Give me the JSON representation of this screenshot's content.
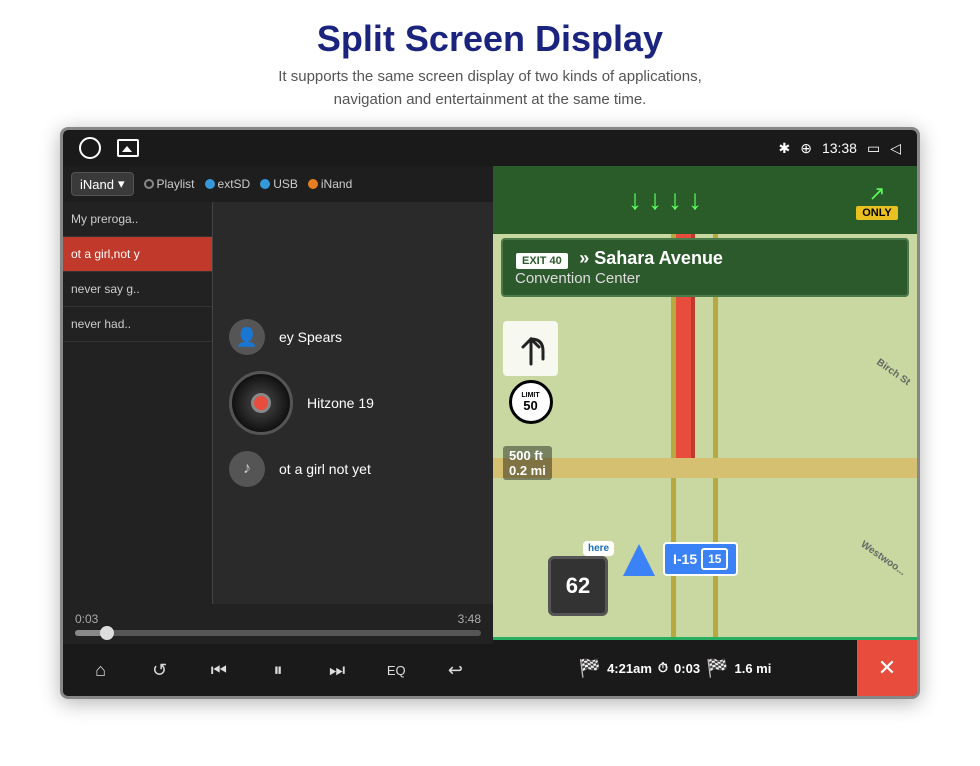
{
  "header": {
    "title": "Split Screen Display",
    "subtitle": "It supports the same screen display of two kinds of applications,\nnavigation and entertainment at the same time."
  },
  "status_bar": {
    "time": "13:38",
    "bluetooth": "✱",
    "location": "⊕"
  },
  "music_player": {
    "source_selected": "iNand",
    "sources": [
      "Playlist",
      "extSD",
      "USB",
      "iNand"
    ],
    "playlist": [
      {
        "title": "My preroga..",
        "active": false
      },
      {
        "title": "ot a girl,not y",
        "active": true
      },
      {
        "title": "never say g..",
        "active": false
      },
      {
        "title": "never had..",
        "active": false
      }
    ],
    "artist": "ey Spears",
    "album": "Hitzone 19",
    "track": "ot a girl not yet",
    "elapsed": "0:03",
    "total": "3:48",
    "progress_pct": 8,
    "controls": {
      "home": "⌂",
      "repeat": "↺",
      "prev": "⏮",
      "play_pause": "⏸",
      "next": "⏭",
      "eq": "EQ",
      "back": "↩"
    }
  },
  "navigation": {
    "exit_number": "EXIT 40",
    "street": "Sahara Avenue",
    "poi": "Convention Center",
    "distance_turn": "500 ft",
    "distance_highway": "0.2 mi",
    "speed": "62",
    "highway": "I-15",
    "highway_num": "15",
    "eta_time": "4:21am",
    "eta_duration": "0:03",
    "eta_distance": "1.6 mi",
    "birch_street": "Birch St",
    "westwood": "Westwoo..."
  }
}
